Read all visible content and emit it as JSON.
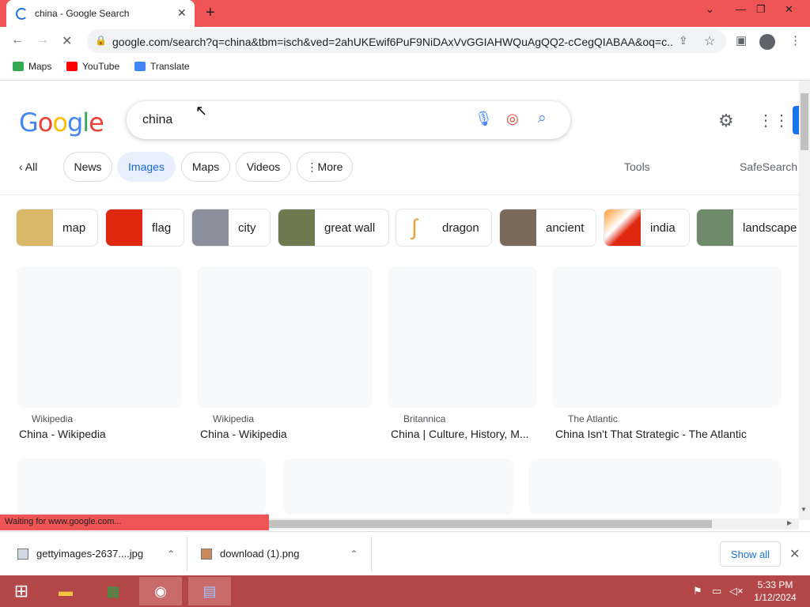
{
  "browser": {
    "tab_title": "china - Google Search",
    "new_tab": "+",
    "url": "google.com/search?q=china&tbm=isch&ved=2ahUKEwif6PuF9NiDAxVvGGIAHWQuAgQQ2-cCegQIABAA&oq=c...",
    "status": "Waiting for www.google.com..."
  },
  "bookmarks": [
    {
      "label": "Maps",
      "icon": "maps-icon",
      "color": "#34a853"
    },
    {
      "label": "YouTube",
      "icon": "youtube-icon",
      "color": "#ff0000"
    },
    {
      "label": "Translate",
      "icon": "translate-icon",
      "color": "#4285f4"
    }
  ],
  "google": {
    "logo": [
      "G",
      "o",
      "o",
      "g",
      "l",
      "e"
    ],
    "query": "china",
    "filters": [
      "All",
      "News",
      "Images",
      "Maps",
      "Videos",
      "More"
    ],
    "active_filter": "Images",
    "tools": "Tools",
    "safesearch": "SafeSearch"
  },
  "suggestions": [
    {
      "label": "map",
      "color": "#d9b86a"
    },
    {
      "label": "flag",
      "color": "#de2910"
    },
    {
      "label": "city",
      "color": "#8a8f9c"
    },
    {
      "label": "great wall",
      "color": "#6d7a4f"
    },
    {
      "label": "dragon",
      "color": "#e8a33c"
    },
    {
      "label": "ancient",
      "color": "#7a6a5c"
    },
    {
      "label": "india",
      "color": "#ff9933"
    },
    {
      "label": "landscape",
      "color": "#6f8a6b"
    }
  ],
  "results": [
    {
      "source": "Wikipedia",
      "title": "China - Wikipedia"
    },
    {
      "source": "Wikipedia",
      "title": "China - Wikipedia"
    },
    {
      "source": "Britannica",
      "title": "China | Culture, History, M..."
    },
    {
      "source": "The Atlantic",
      "title": "China Isn't That Strategic - The Atlantic"
    }
  ],
  "downloads": [
    {
      "name": "gettyimages-2637....jpg"
    },
    {
      "name": "download (1).png"
    }
  ],
  "shelf": {
    "show_all": "Show all"
  },
  "clock": {
    "time": "5:33 PM",
    "date": "1/12/2024"
  },
  "colors": {
    "accent": "#f05555",
    "google_blue": "#1a73e8"
  }
}
